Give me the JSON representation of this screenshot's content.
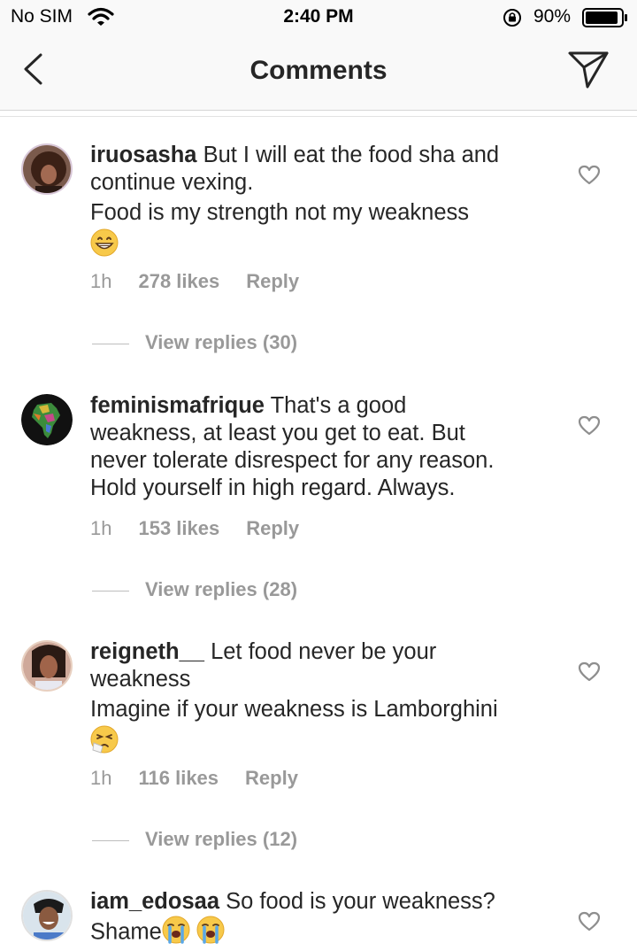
{
  "status": {
    "carrier": "No SIM",
    "time": "2:40 PM",
    "battery": "90%"
  },
  "nav": {
    "title": "Comments"
  },
  "colors": {
    "text": "#262626",
    "muted": "#999999",
    "bar": "#f9f9f9"
  },
  "comments": [
    {
      "username": "iruosasha",
      "text_first": "But I will eat the food sha and",
      "text_lines": [
        "continue vexing.",
        "Food is my strength not my weakness"
      ],
      "emoji": "grinning-face",
      "time": "1h",
      "likes": "278 likes",
      "reply": "Reply",
      "view_replies": "View replies (30)"
    },
    {
      "username": "feminismafrique",
      "text_first": "That's a good",
      "text_lines": [
        "weakness, at least you get to eat. But",
        "never tolerate disrespect for any reason.",
        "Hold yourself in high regard. Always."
      ],
      "time": "1h",
      "likes": "153 likes",
      "reply": "Reply",
      "view_replies": "View replies (28)"
    },
    {
      "username": "reigneth__",
      "text_first": "Let food never be your",
      "text_lines": [
        "weakness",
        "Imagine if your weakness is Lamborghini"
      ],
      "emoji": "sneezing-face",
      "time": "1h",
      "likes": "116 likes",
      "reply": "Reply",
      "view_replies": "View replies (12)"
    },
    {
      "username": "iam_edosaa",
      "text_first": "So food is your weakness?",
      "text_last": "Shame",
      "emoji": "crying-face"
    }
  ]
}
